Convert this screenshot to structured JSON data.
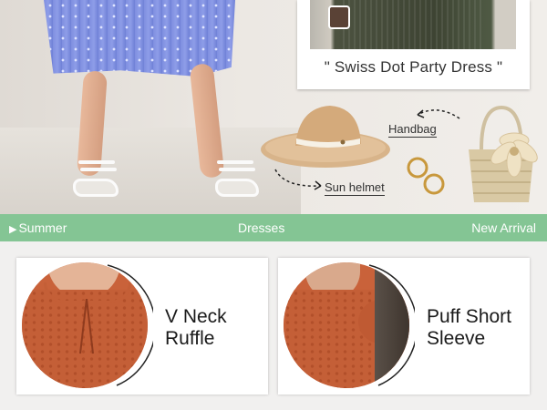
{
  "hero": {
    "card_title": "\" Swiss Dot Party Dress \"",
    "handbag_label": "Handbag",
    "helmet_label": "Sun helmet"
  },
  "banner": {
    "left": "Summer",
    "middle": "Dresses",
    "right": "New Arrival",
    "background": "#84c594"
  },
  "products": [
    {
      "name_line1": "V Neck",
      "name_line2": "Ruffle"
    },
    {
      "name_line1": "Puff Short",
      "name_line2": "Sleeve"
    }
  ],
  "colors": {
    "accent_green": "#84c594",
    "rust": "#c45f37",
    "skirt_blue": "#7f8fe0"
  }
}
